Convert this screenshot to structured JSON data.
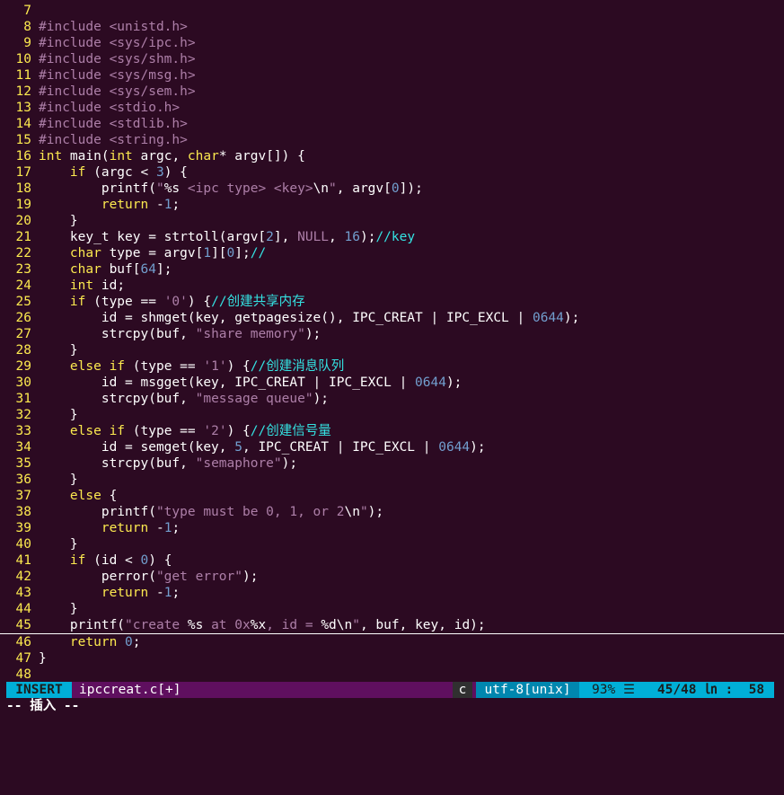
{
  "editor": {
    "lines": [
      {
        "n": "7",
        "html": ""
      },
      {
        "n": "8",
        "html": "<span class='pp'>#include</span> <span class='inc'>&lt;unistd.h&gt;</span>"
      },
      {
        "n": "9",
        "html": "<span class='pp'>#include</span> <span class='inc'>&lt;sys/ipc.h&gt;</span>"
      },
      {
        "n": "10",
        "html": "<span class='pp'>#include</span> <span class='inc'>&lt;sys/shm.h&gt;</span>"
      },
      {
        "n": "11",
        "html": "<span class='pp'>#include</span> <span class='inc'>&lt;sys/msg.h&gt;</span>"
      },
      {
        "n": "12",
        "html": "<span class='pp'>#include</span> <span class='inc'>&lt;sys/sem.h&gt;</span>"
      },
      {
        "n": "13",
        "html": "<span class='pp'>#include</span> <span class='inc'>&lt;stdio.h&gt;</span>"
      },
      {
        "n": "14",
        "html": "<span class='pp'>#include</span> <span class='inc'>&lt;stdlib.h&gt;</span>"
      },
      {
        "n": "15",
        "html": "<span class='pp'>#include</span> <span class='inc'>&lt;string.h&gt;</span>"
      },
      {
        "n": "16",
        "html": "<span class='ty'>int</span> main(<span class='ty'>int</span> argc, <span class='ty'>char</span>* argv[]) {"
      },
      {
        "n": "17",
        "html": "    <span class='kw'>if</span> (argc &lt; <span class='num'>3</span>) {"
      },
      {
        "n": "18",
        "html": "        printf(<span class='str'>\"</span>%s<span class='str'> &lt;ipc type&gt; &lt;key&gt;</span>\\n<span class='str'>\"</span>, argv[<span class='num'>0</span>]);"
      },
      {
        "n": "19",
        "html": "        <span class='kw'>return</span> -<span class='num'>1</span>;"
      },
      {
        "n": "20",
        "html": "    }"
      },
      {
        "n": "21",
        "html": "    key_t key = strtoll(argv[<span class='num'>2</span>], <span class='con'>NULL</span>, <span class='num'>16</span>);<span class='cm'>//key</span>"
      },
      {
        "n": "22",
        "html": "    <span class='ty'>char</span> type = argv[<span class='num'>1</span>][<span class='num'>0</span>];<span class='cm'>//</span>"
      },
      {
        "n": "23",
        "html": "    <span class='ty'>char</span> buf[<span class='num'>64</span>];"
      },
      {
        "n": "24",
        "html": "    <span class='ty'>int</span> id;"
      },
      {
        "n": "25",
        "html": "    <span class='kw'>if</span> (type == <span class='str'>'0'</span>) {<span class='cm'>//创建共享内存</span>"
      },
      {
        "n": "26",
        "html": "        id = shmget(key, getpagesize(), IPC_CREAT | IPC_EXCL | <span class='num'>0644</span>);"
      },
      {
        "n": "27",
        "html": "        strcpy(buf, <span class='str'>\"share memory\"</span>);"
      },
      {
        "n": "28",
        "html": "    }"
      },
      {
        "n": "29",
        "html": "    <span class='kw'>else</span> <span class='kw'>if</span> (type == <span class='str'>'1'</span>) {<span class='cm'>//创建消息队列</span>"
      },
      {
        "n": "30",
        "html": "        id = msgget(key, IPC_CREAT | IPC_EXCL | <span class='num'>0644</span>);"
      },
      {
        "n": "31",
        "html": "        strcpy(buf, <span class='str'>\"message queue\"</span>);"
      },
      {
        "n": "32",
        "html": "    }"
      },
      {
        "n": "33",
        "html": "    <span class='kw'>else</span> <span class='kw'>if</span> (type == <span class='str'>'2'</span>) {<span class='cm'>//创建信号量</span>"
      },
      {
        "n": "34",
        "html": "        id = semget(key, <span class='num'>5</span>, IPC_CREAT | IPC_EXCL | <span class='num'>0644</span>);"
      },
      {
        "n": "35",
        "html": "        strcpy(buf, <span class='str'>\"semaphore\"</span>);"
      },
      {
        "n": "36",
        "html": "    }"
      },
      {
        "n": "37",
        "html": "    <span class='kw'>else</span> {"
      },
      {
        "n": "38",
        "html": "        printf(<span class='str'>\"type must be 0, 1, or 2</span>\\n<span class='str'>\"</span>);"
      },
      {
        "n": "39",
        "html": "        <span class='kw'>return</span> -<span class='num'>1</span>;"
      },
      {
        "n": "40",
        "html": "    }"
      },
      {
        "n": "41",
        "html": "    <span class='kw'>if</span> (id &lt; <span class='num'>0</span>) {"
      },
      {
        "n": "42",
        "html": "        perror(<span class='str'>\"get error\"</span>);"
      },
      {
        "n": "43",
        "html": "        <span class='kw'>return</span> -<span class='num'>1</span>;"
      },
      {
        "n": "44",
        "html": "    }"
      },
      {
        "n": "45",
        "html": "    printf(<span class='str'>\"create </span>%s<span class='str'> at 0x</span>%x<span class='str'>, id = </span>%d\\n<span class='str'>\"</span>, buf, key, id);",
        "cursor": true
      },
      {
        "n": "46",
        "html": "    <span class='kw'>return</span> <span class='num'>0</span>;"
      },
      {
        "n": "47",
        "html": "}"
      },
      {
        "n": "48",
        "html": ""
      }
    ]
  },
  "statusbar": {
    "mode": "INSERT",
    "filename": "ipccreat.c[+]",
    "filetype": "c",
    "encoding": "utf-8[unix]",
    "percent": "93% ☰",
    "position": "45/48 ㏑ :  58"
  },
  "cmdline": {
    "text": "-- 插入 --"
  },
  "colors": {
    "background": "#2c0a22",
    "line_number": "#fce94f",
    "keyword": "#fce94f",
    "string": "#ad7fa8",
    "number": "#729fcf",
    "comment": "#34e2e2",
    "statusbar_accent": "#00afd7",
    "statusbar_bg": "#5f0f5f"
  }
}
